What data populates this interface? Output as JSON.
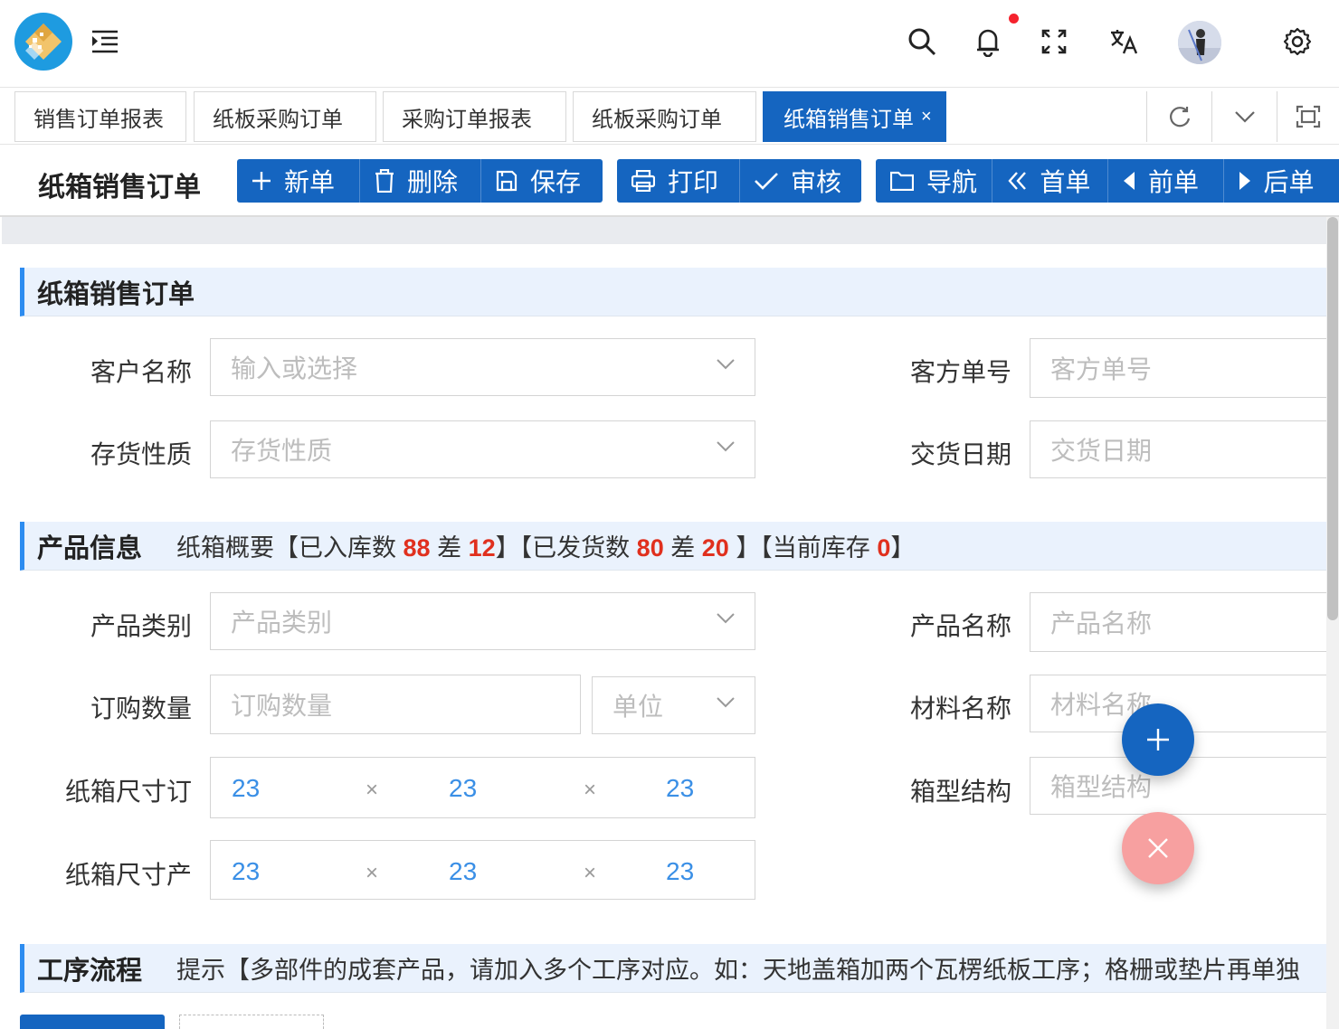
{
  "colors": {
    "primary": "#1565c0",
    "accent_red": "#e0301e",
    "section_bg": "#eaf2fd",
    "dimension_blue": "#3a8fe6",
    "fab_close": "#f7a0a0"
  },
  "header": {
    "icons": [
      "logo",
      "menu-indent-icon",
      "search-icon",
      "bell-icon",
      "fullscreen-icon",
      "translate-icon",
      "avatar",
      "gear-icon"
    ]
  },
  "tabs": [
    {
      "label": "销售订单报表"
    },
    {
      "label": "纸板采购订单"
    },
    {
      "label": "采购订单报表"
    },
    {
      "label": "纸板采购订单"
    },
    {
      "label": "纸箱销售订单",
      "active": true,
      "close": "×"
    }
  ],
  "toolbar": {
    "title": "纸箱销售订单",
    "new_label": "新单",
    "delete_label": "删除",
    "save_label": "保存",
    "print_label": "打印",
    "audit_label": "审核",
    "nav_label": "导航",
    "first_label": "首单",
    "prev_label": "前单",
    "next_label": "后单"
  },
  "section1": {
    "title": "纸箱销售订单",
    "customer_label": "客户名称",
    "customer_placeholder": "输入或选择",
    "client_no_label": "客方单号",
    "client_no_placeholder": "客方单号",
    "stock_label": "存货性质",
    "stock_placeholder": "存货性质",
    "delivery_label": "交货日期",
    "delivery_placeholder": "交货日期"
  },
  "section2": {
    "title": "产品信息",
    "summary_prefix": "纸箱概要【已入库数",
    "in_stock": "88",
    "diff_label1": "差",
    "in_diff": "12",
    "summary_mid": "】【已发货数",
    "shipped": "80",
    "diff_label2": "差",
    "ship_diff": "20",
    "summary_mid2": "】【当前库存",
    "current_stock": "0",
    "summary_end": "】",
    "category_label": "产品类别",
    "category_placeholder": "产品类别",
    "name_label": "产品名称",
    "name_placeholder": "产品名称",
    "qty_label": "订购数量",
    "qty_placeholder": "订购数量",
    "unit_placeholder": "单位",
    "material_label": "材料名称",
    "material_placeholder": "材料名称",
    "size_order_label": "纸箱尺寸订",
    "box_type_label": "箱型结构",
    "box_type_placeholder": "箱型结构",
    "size_prod_label": "纸箱尺寸产",
    "size_order": [
      "23",
      "23",
      "23"
    ],
    "size_prod": [
      "23",
      "23",
      "23"
    ],
    "times": "×"
  },
  "section3": {
    "title": "工序流程",
    "hint": "提示【多部件的成套产品，请加入多个工序对应。如：天地盖箱加两个瓦楞纸板工序；格栅或垫片再单独"
  }
}
